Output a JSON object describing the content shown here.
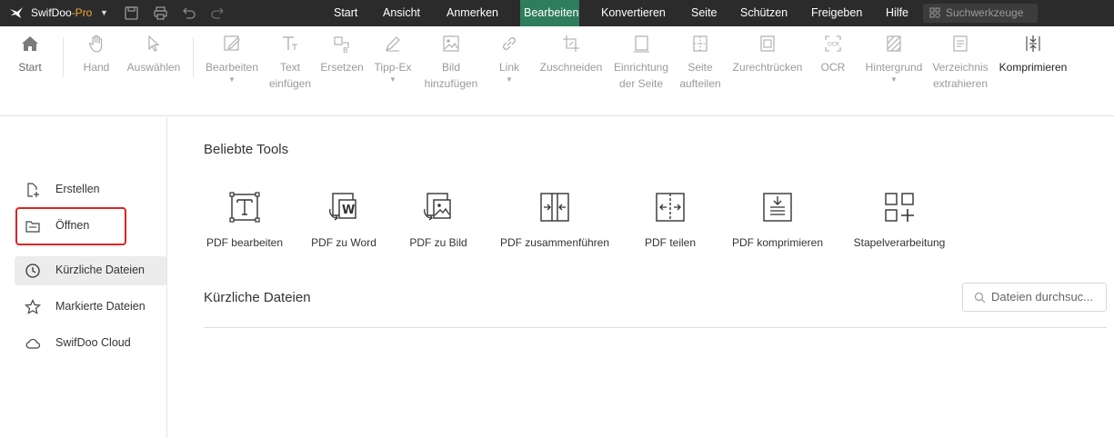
{
  "titlebar": {
    "app_name": "SwifDoo",
    "app_edition": "-Pro",
    "menus": [
      {
        "label": "Start"
      },
      {
        "label": "Ansicht"
      },
      {
        "label": "Anmerken"
      },
      {
        "label": "Bearbeiten",
        "active": true
      },
      {
        "label": "Konvertieren"
      },
      {
        "label": "Seite"
      },
      {
        "label": "Schützen"
      },
      {
        "label": "Freigeben"
      },
      {
        "label": "Hilfe"
      }
    ],
    "search_placeholder": "Suchwerkzeuge"
  },
  "ribbon": {
    "start": "Start",
    "hand": "Hand",
    "select": "Auswählen",
    "edit": "Bearbeiten",
    "text_l1": "Text",
    "text_l2": "einfügen",
    "replace": "Ersetzen",
    "tippex": "Tipp-Ex",
    "image_l1": "Bild",
    "image_l2": "hinzufügen",
    "link": "Link",
    "crop": "Zuschneiden",
    "pagesetup_l1": "Einrichtung",
    "pagesetup_l2": "der Seite",
    "split_l1": "Seite",
    "split_l2": "aufteilen",
    "straighten": "Zurechtrücken",
    "ocr": "OCR",
    "background": "Hintergrund",
    "toc_l1": "Verzeichnis",
    "toc_l2": "extrahieren",
    "compress": "Komprimieren"
  },
  "sidebar": {
    "items": [
      {
        "label": "Erstellen",
        "icon": "create-file-icon"
      },
      {
        "label": "Öffnen",
        "icon": "folder-icon"
      },
      {
        "label": "Kürzliche Dateien",
        "icon": "clock-icon"
      },
      {
        "label": "Markierte Dateien",
        "icon": "star-icon"
      },
      {
        "label": "SwifDoo Cloud",
        "icon": "cloud-icon"
      }
    ]
  },
  "main": {
    "popular_title": "Beliebte Tools",
    "tools": [
      {
        "label": "PDF bearbeiten",
        "icon": "edit-text-icon"
      },
      {
        "label": "PDF zu Word",
        "icon": "pdf-to-word-icon"
      },
      {
        "label": "PDF zu Bild",
        "icon": "pdf-to-image-icon"
      },
      {
        "label": "PDF zusammenführen",
        "icon": "merge-icon"
      },
      {
        "label": "PDF teilen",
        "icon": "split-icon"
      },
      {
        "label": "PDF komprimieren",
        "icon": "compress-icon"
      },
      {
        "label": "Stapelverarbeitung",
        "icon": "batch-icon"
      }
    ],
    "recent_title": "Kürzliche Dateien",
    "recent_search_placeholder": "Dateien durchsuc..."
  },
  "colors": {
    "titlebar_bg": "#2b2b2b",
    "active_menu": "#2e7d5b",
    "edition_orange": "#f3a63b",
    "highlight_red": "#e02424"
  }
}
